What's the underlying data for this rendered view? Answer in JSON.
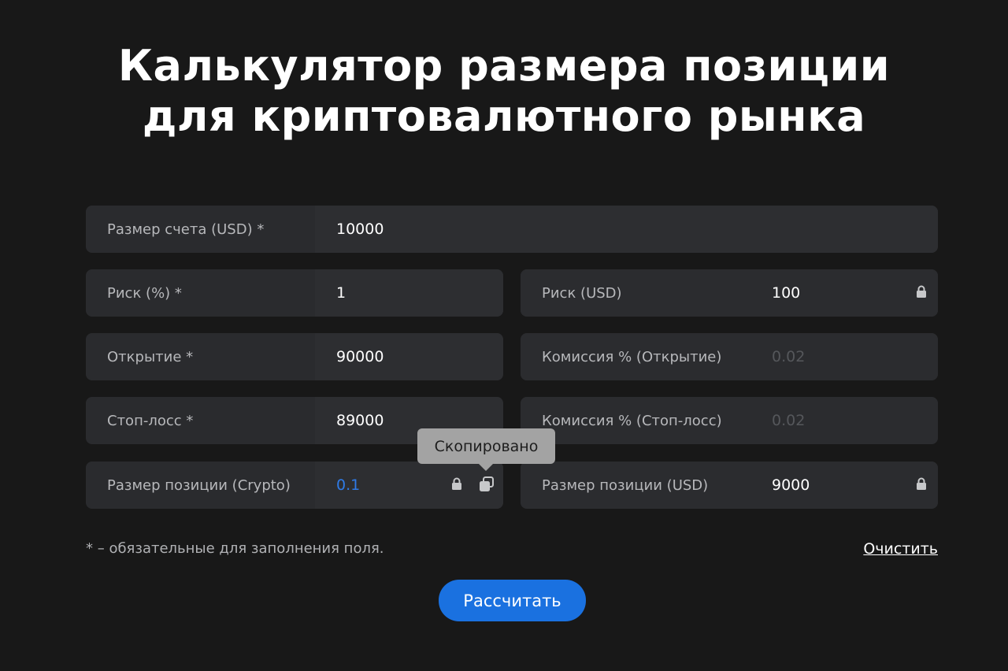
{
  "title": {
    "line1": "Калькулятор размера позиции",
    "line2": "для криптовалютного рынка"
  },
  "fields": {
    "account_size": {
      "label": "Размер счета (USD) *",
      "value": "10000"
    },
    "risk_percent": {
      "label": "Риск (%) *",
      "value": "1"
    },
    "risk_usd": {
      "label": "Риск (USD)",
      "value": "100"
    },
    "open": {
      "label": "Открытие *",
      "value": "90000"
    },
    "commission_open": {
      "label": "Комиссия % (Открытие)",
      "placeholder": "0.02"
    },
    "stop_loss": {
      "label": "Стоп-лосс *",
      "value": "89000"
    },
    "commission_stop": {
      "label": "Комиссия % (Стоп-лосс)",
      "placeholder": "0.02"
    },
    "position_crypto": {
      "label": "Размер позиции (Crypto)",
      "value": "0.1"
    },
    "position_usd": {
      "label": "Размер позиции (USD)",
      "value": "9000"
    }
  },
  "tooltip": {
    "text": "Скопировано"
  },
  "footer": {
    "note": "* – обязательные для заполнения поля.",
    "clear_label": "Очистить",
    "calculate_label": "Рассчитать"
  },
  "icons": {
    "lock": "lock-icon",
    "copy": "copy-icon"
  },
  "colors": {
    "background": "#181818",
    "field": "#2d2e31",
    "accent_blue": "#1a71e0",
    "result_blue": "#2f7be6",
    "tooltip": "#a3a3a3"
  }
}
